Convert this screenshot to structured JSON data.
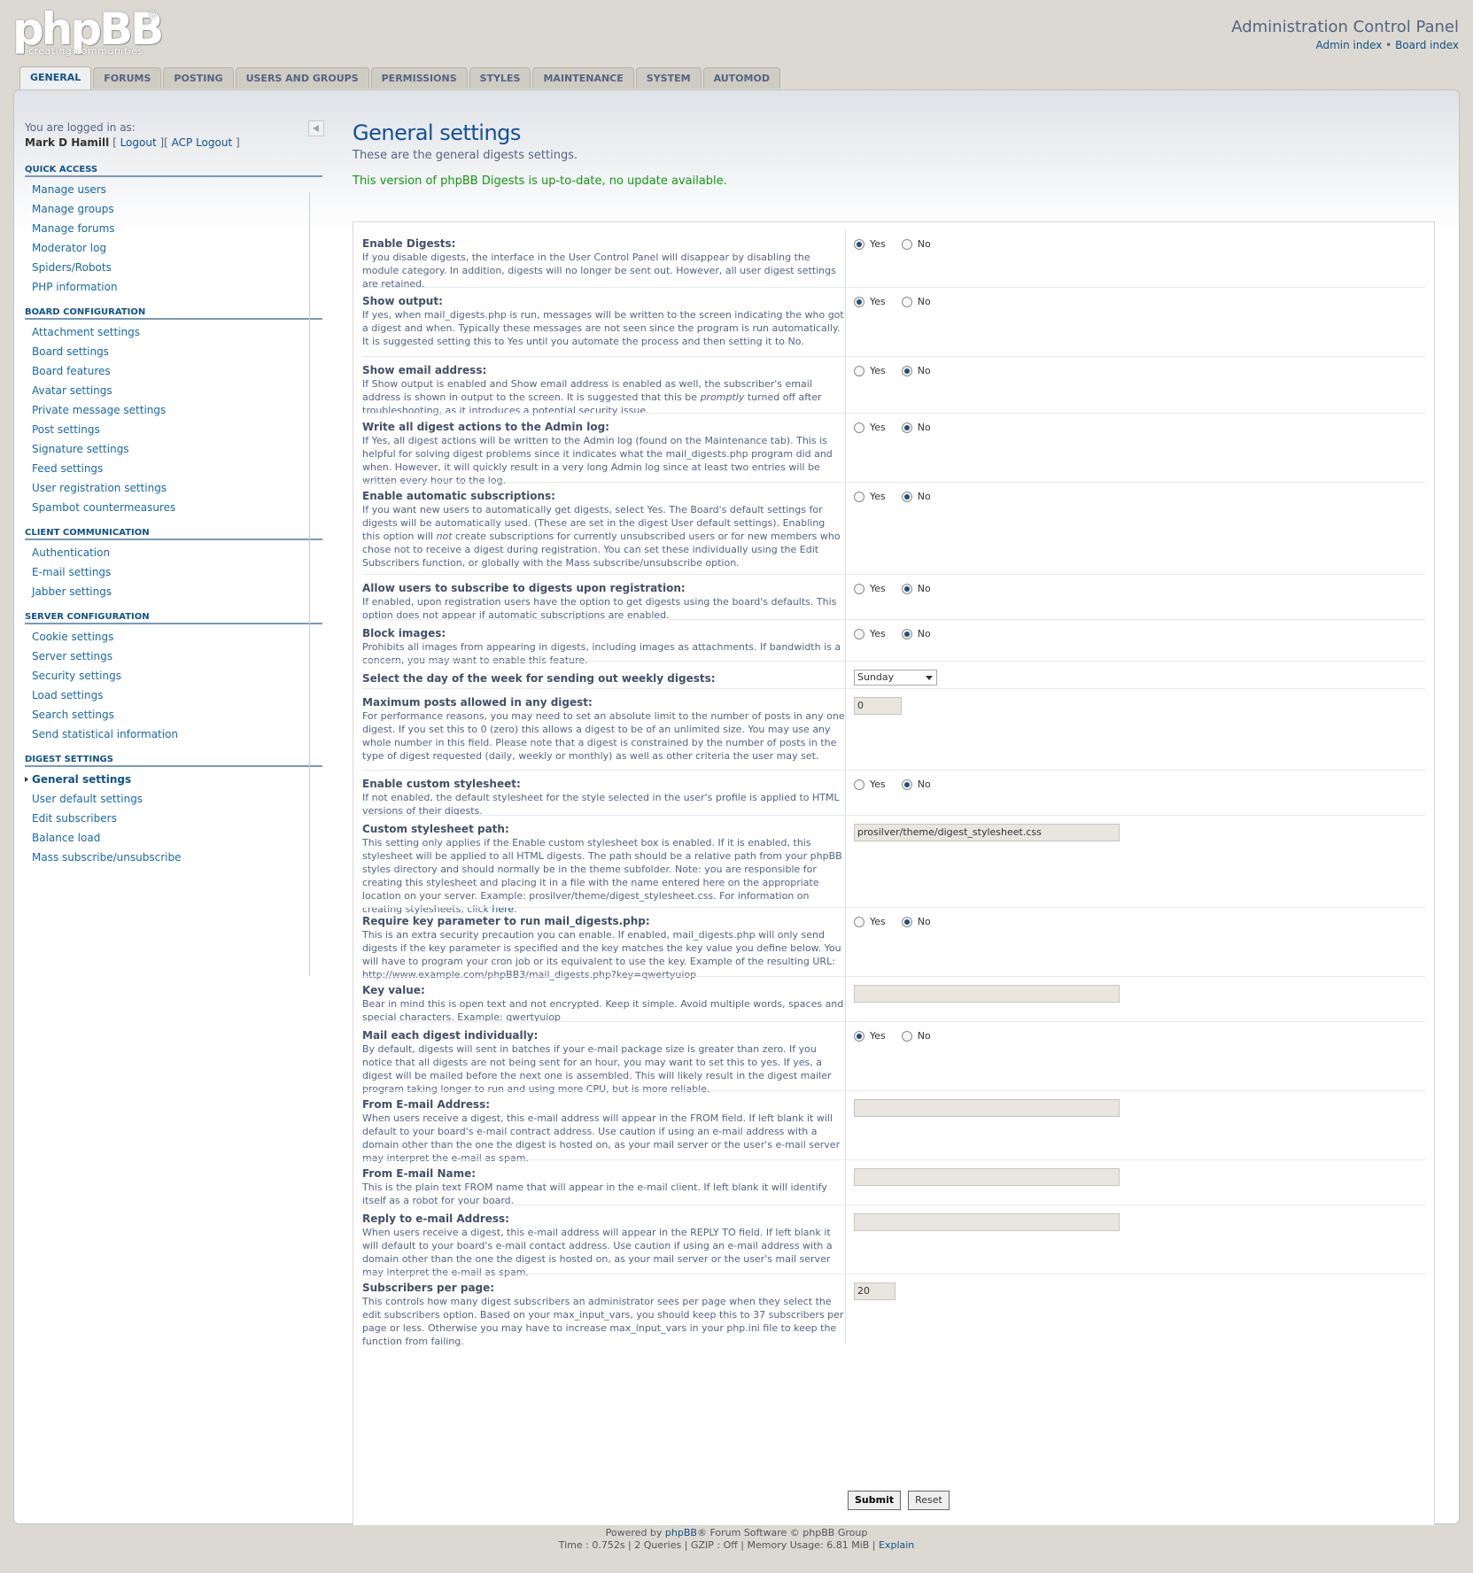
{
  "header": {
    "logo_main": "phpBB",
    "logo_reg": "®",
    "logo_tagline": "creating communities",
    "title": "Administration Control Panel",
    "link_admin": "Admin index",
    "link_sep": " • ",
    "link_board": "Board index"
  },
  "tabs": [
    "GENERAL",
    "FORUMS",
    "POSTING",
    "USERS AND GROUPS",
    "PERMISSIONS",
    "STYLES",
    "MAINTENANCE",
    "SYSTEM",
    "AUTOMOD"
  ],
  "menu": {
    "logged_in": "You are logged in as:",
    "user": "Mark D Hamill",
    "logout_open": " [ ",
    "logout": "Logout",
    "mid": " ][ ",
    "acp_logout": "ACP Logout",
    "close": " ]",
    "blocks": [
      {
        "heading": "QUICK ACCESS",
        "items": [
          "Manage users",
          "Manage groups",
          "Manage forums",
          "Moderator log",
          "Spiders/Robots",
          "PHP information"
        ]
      },
      {
        "heading": "BOARD CONFIGURATION",
        "items": [
          "Attachment settings",
          "Board settings",
          "Board features",
          "Avatar settings",
          "Private message settings",
          "Post settings",
          "Signature settings",
          "Feed settings",
          "User registration settings",
          "Spambot countermeasures"
        ]
      },
      {
        "heading": "CLIENT COMMUNICATION",
        "items": [
          "Authentication",
          "E-mail settings",
          "Jabber settings"
        ]
      },
      {
        "heading": "SERVER CONFIGURATION",
        "items": [
          "Cookie settings",
          "Server settings",
          "Security settings",
          "Load settings",
          "Search settings",
          "Send statistical information"
        ]
      },
      {
        "heading": "DIGEST SETTINGS",
        "items": [
          "General settings",
          "User default settings",
          "Edit subscribers",
          "Balance load",
          "Mass subscribe/unsubscribe"
        ]
      }
    ]
  },
  "main": {
    "title": "General settings",
    "description": "These are the general digests settings.",
    "success": "This version of phpBB Digests is up-to-date, no update available.",
    "yes": "Yes",
    "no": "No",
    "submit": "Submit",
    "reset": "Reset",
    "rows": [
      {
        "title": "Enable Digests:",
        "desc": "If you disable digests, the interface in the User Control Panel will disappear by disabling the module category. In addition, digests will no longer be sent out. However, all user digest settings are retained.",
        "selected": "yes"
      },
      {
        "title": "Show output:",
        "desc": "If yes, when mail_digests.php is run, messages will be written to the screen indicating the who got a digest and when. Typically these messages are not seen since the program is run automatically. It is suggested setting this to Yes until you automate the process and then setting it to No.",
        "selected": "yes"
      },
      {
        "title": "Show email address:",
        "desc_a": "If Show output is enabled and Show email address is enabled as well, the subscriber's email address is shown in output to the screen. It is suggested that this be ",
        "desc_em": "promptly",
        "desc_b": " turned off after troubleshooting, as it introduces a potential security issue.",
        "selected": "no"
      },
      {
        "title": "Write all digest actions to the Admin log:",
        "desc": "If Yes, all digest actions will be written to the Admin log (found on the Maintenance tab). This is helpful for solving digest problems since it indicates what the mail_digests.php program did and when. However, it will quickly result in a very long Admin log since at least two entries will be written every hour to the log.",
        "selected": "no"
      },
      {
        "title": "Enable automatic subscriptions:",
        "desc_a": "If you want new users to automatically get digests, select Yes. The Board's default settings for digests will be automatically used. (These are set in the digest User default settings). Enabling this option will ",
        "desc_em": "not",
        "desc_b": " create subscriptions for currently unsubscribed users or for new members who chose not to receive a digest during registration. You can set these individually using the Edit Subscribers function, or globally with the Mass subscribe/unsubscribe option.",
        "selected": "no"
      },
      {
        "title": "Allow users to subscribe to digests upon registration:",
        "desc": "If enabled, upon registration users have the option to get digests using the board's defaults. This option does not appear if automatic subscriptions are enabled.",
        "selected": "no"
      },
      {
        "title": "Block images:",
        "desc": "Prohibits all images from appearing in digests, including images as attachments. If bandwidth is a concern, you may want to enable this feature.",
        "selected": "no"
      },
      {
        "title": "Select the day of the week for sending out weekly digests:",
        "select_value": "Sunday"
      },
      {
        "title": "Maximum posts allowed in any digest:",
        "desc": "For performance reasons, you may need to set an absolute limit to the number of posts in any one digest. If you set this to 0 (zero) this allows a digest to be of an unlimited size. You may use any whole number in this field. Please note that a digest is constrained by the number of posts in the type of digest requested (daily, weekly or monthly) as well as other criteria the user may set.",
        "input_value": "0"
      },
      {
        "title": "Enable custom stylesheet:",
        "desc": "If not enabled, the default stylesheet for the style selected in the user's profile is applied to HTML versions of their digests.",
        "selected": "no"
      },
      {
        "title": "Custom stylesheet path:",
        "desc_a": "This setting only applies if the Enable custom stylesheet box is enabled. If it is enabled, this stylesheet will be applied to all HTML digests. The path should be a relative path from your phpBB styles directory and should normally be in the theme subfolder. Note: you are responsible for creating this stylesheet and placing it in a file with the name entered here on the appropriate location on your server. Example: prosilver/theme/digest_stylesheet.css. For information on creating stylesheets, click ",
        "desc_link": "here",
        "desc_b": ".",
        "input_value": "prosilver/theme/digest_stylesheet.css"
      },
      {
        "title": "Require key parameter to run mail_digests.php:",
        "desc": "This is an extra security precaution you can enable. If enabled, mail_digests.php will only send digests if the key parameter is specified and the key matches the key value you define below. You will have to program your cron job or its equivalent to use the key. Example of the resulting URL: http://www.example.com/phpBB3/mail_digests.php?key=qwertyuiop",
        "selected": "no"
      },
      {
        "title": "Key value:",
        "desc": "Bear in mind this is open text and not encrypted. Keep it simple. Avoid multiple words, spaces and special characters. Example: qwertyuiop",
        "input_value": ""
      },
      {
        "title": "Mail each digest individually:",
        "desc": "By default, digests will sent in batches if your e-mail package size is greater than zero. If you notice that all digests are not being sent for an hour, you may want to set this to yes. If yes, a digest will be mailed before the next one is assembled. This will likely result in the digest mailer program taking longer to run and using more CPU, but is more reliable.",
        "selected": "yes"
      },
      {
        "title": "From E-mail Address:",
        "desc": "When users receive a digest, this e-mail address will appear in the FROM field. If left blank it will default to your board's e-mail contract address. Use caution if using an e-mail address with a domain other than the one the digest is hosted on, as your mail server or the user's e-mail server may interpret the e-mail as spam.",
        "input_value": ""
      },
      {
        "title": "From E-mail Name:",
        "desc": "This is the plain text FROM name that will appear in the e-mail client. If left blank it will identify itself as a robot for your board.",
        "input_value": ""
      },
      {
        "title": "Reply to e-mail Address:",
        "desc": "When users receive a digest, this e-mail address will appear in the REPLY TO field. If left blank it will default to your board's e-mail contact address. Use caution if using an e-mail address with a domain other than the one the digest is hosted on, as your mail server or the user's mail server may interpret the e-mail as spam.",
        "input_value": ""
      },
      {
        "title": "Subscribers per page:",
        "desc": "This controls how many digest subscribers an administrator sees per page when they select the edit subscribers option. Based on your max_input_vars, you should keep this to 37 subscribers per page or less. Otherwise you may have to increase max_input_vars in your php.ini file to keep the function from failing.",
        "input_value": "20"
      }
    ]
  },
  "footer": {
    "powered_a": "Powered by ",
    "powered_link": "phpBB",
    "powered_b": "® Forum Software © phpBB Group",
    "stats": "Time : 0.752s | 2 Queries | GZIP : Off | Memory Usage: 6.81 MiB | ",
    "explain": "Explain"
  }
}
